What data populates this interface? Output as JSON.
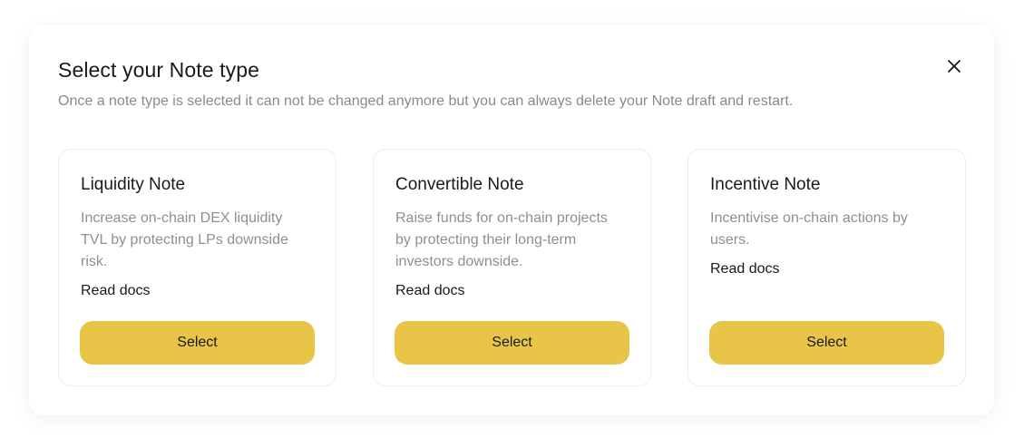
{
  "modal": {
    "title": "Select your Note type",
    "subtitle": "Once a note type is selected it can not be changed anymore but you can always delete your Note draft and restart.",
    "close_icon": "close-icon"
  },
  "cards": [
    {
      "title": "Liquidity Note",
      "description": "Increase on-chain DEX liquidity TVL by protecting LPs downside risk.",
      "read_docs": "Read docs",
      "button": "Select"
    },
    {
      "title": "Convertible Note",
      "description": "Raise funds for on-chain projects by protecting their long-term investors downside.",
      "read_docs": "Read docs",
      "button": "Select"
    },
    {
      "title": "Incentive Note",
      "description": "Incentivise on-chain actions by users.",
      "read_docs": "Read docs",
      "button": "Select"
    }
  ],
  "colors": {
    "accent": "#e8c547",
    "text": "#1a1a1a",
    "muted": "#8f8f8f",
    "border": "#ececec"
  }
}
